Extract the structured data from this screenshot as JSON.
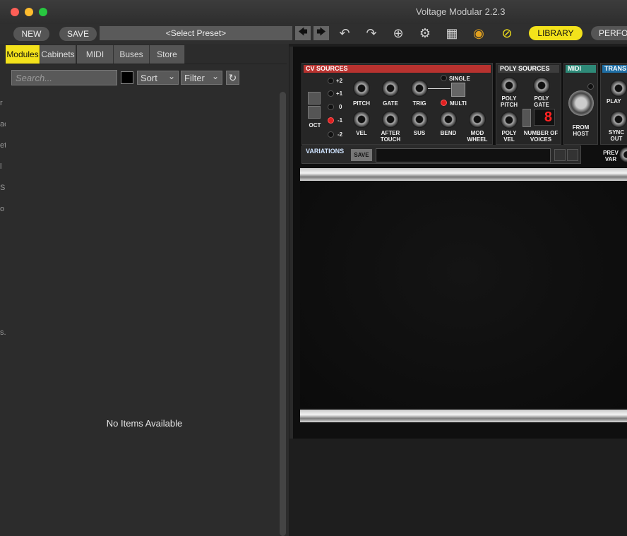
{
  "window": {
    "title": "Voltage Modular 2.2.3"
  },
  "toolbar": {
    "new_label": "NEW",
    "save_label": "SAVE",
    "preset_label": "<Select Preset>",
    "prev_symbol": "🡄",
    "next_symbol": "🡆",
    "icons": {
      "undo": "↶",
      "redo": "↷",
      "zoom": "⊕",
      "settings": "⚙",
      "grid": "▦",
      "colors": "◉",
      "patch": "⊘"
    },
    "library_label": "LIBRARY",
    "perform_label": "PERFO"
  },
  "sidebar": {
    "tabs": [
      {
        "label": "Modules"
      },
      {
        "label": "Cabinets"
      },
      {
        "label": "MIDI"
      },
      {
        "label": "Buses"
      },
      {
        "label": "Store"
      }
    ],
    "search_placeholder": "Search...",
    "sort_label": "Sort",
    "filter_label": "Filter",
    "refresh_symbol": "↻",
    "empty_message": "No Items Available",
    "edge_fragments": [
      "r",
      "ac",
      "et",
      "l",
      "S",
      "o",
      "s."
    ]
  },
  "rack": {
    "cv_sources": {
      "title": "CV SOURCES",
      "oct_label": "OCT",
      "oct_levels": [
        "+2",
        "+1",
        "0",
        "-1",
        "-2"
      ],
      "jacks_top": [
        "PITCH",
        "GATE",
        "TRIG"
      ],
      "jacks_bottom": [
        "VEL",
        "AFTER TOUCH",
        "SUS",
        "BEND",
        "MOD WHEEL"
      ],
      "single_label": "SINGLE",
      "multi_label": "MULTI"
    },
    "poly_sources": {
      "title": "POLY SOURCES",
      "jacks": [
        "POLY PITCH",
        "POLY GATE",
        "POLY VEL"
      ],
      "voices_label": "NUMBER OF VOICES",
      "voices_value": "8"
    },
    "midi": {
      "title": "MIDI",
      "from_host": "FROM HOST"
    },
    "transport": {
      "title": "TRANS",
      "play": "PLAY",
      "sync_out": "SYNC OUT"
    },
    "variations": {
      "title": "VARIATIONS",
      "save": "SAVE",
      "prev_var": "PREV VAR"
    }
  },
  "colors": {
    "accent": "#f3e21b",
    "cv_header": "#b8322f",
    "poly_header": "#3d3d3d",
    "midi_header": "#2e8a78",
    "trans_header": "#1f6fa5"
  }
}
